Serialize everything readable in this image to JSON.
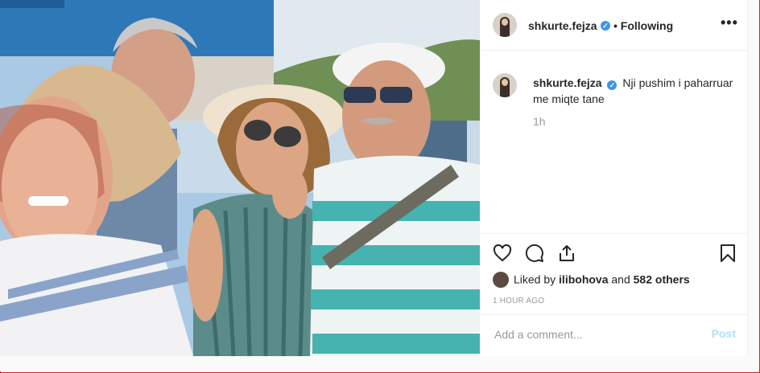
{
  "post": {
    "username": "shkurte.fejza",
    "follow_status": "Following",
    "separator": "•",
    "more_icon": "more-options-icon",
    "caption": {
      "username": "shkurte.fejza",
      "text": "Nji pushim i paharruar me miqte tane"
    },
    "time_ago": "1h",
    "likes": {
      "prefix": "Liked by",
      "liker": "ilibohova",
      "conjunction": "and",
      "others": "582 others"
    },
    "posted_time": "1 HOUR AGO",
    "comment": {
      "placeholder": "Add a comment...",
      "post_label": "Post"
    },
    "icons": [
      "heart-icon",
      "comment-icon",
      "share-icon",
      "bookmark-icon",
      "verified-badge-icon"
    ]
  }
}
